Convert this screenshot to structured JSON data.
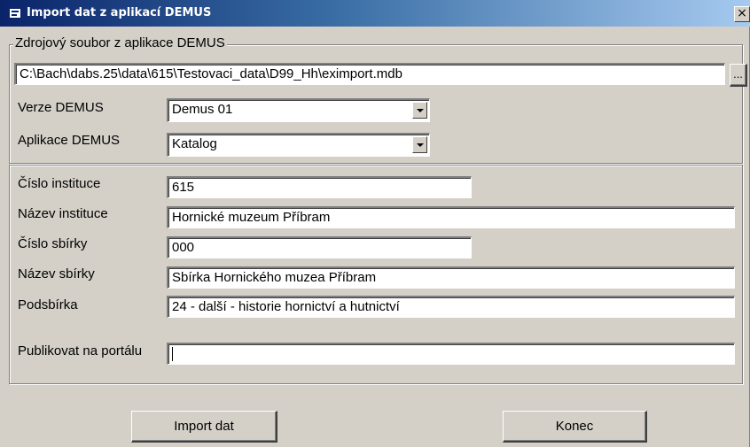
{
  "window": {
    "title": "Import dat z aplikací DEMUS",
    "close_glyph": "×"
  },
  "source": {
    "legend": "Zdrojový soubor z aplikace DEMUS",
    "path": "C:\\Bach\\dabs.25\\data\\615\\Testovaci_data\\D99_Hh\\eximport.mdb",
    "browse_label": "..."
  },
  "version": {
    "label": "Verze DEMUS",
    "value": "Demus 01"
  },
  "application": {
    "label": "Aplikace DEMUS",
    "value": "Katalog"
  },
  "institution_number": {
    "label": "Číslo instituce",
    "value": "615"
  },
  "institution_name": {
    "label": "Název instituce",
    "value": "Hornické muzeum Příbram"
  },
  "collection_number": {
    "label": "Číslo sbírky",
    "value": "000"
  },
  "collection_name": {
    "label": "Název sbírky",
    "value": "Sbírka Hornického muzea Příbram"
  },
  "subcollection": {
    "label": "Podsbírka",
    "value": "24 - další - historie hornictví a hutnictví"
  },
  "publish": {
    "label": "Publikovat na portálu",
    "value": ""
  },
  "buttons": {
    "import_label": "Import dat",
    "close_label": "Konec"
  }
}
